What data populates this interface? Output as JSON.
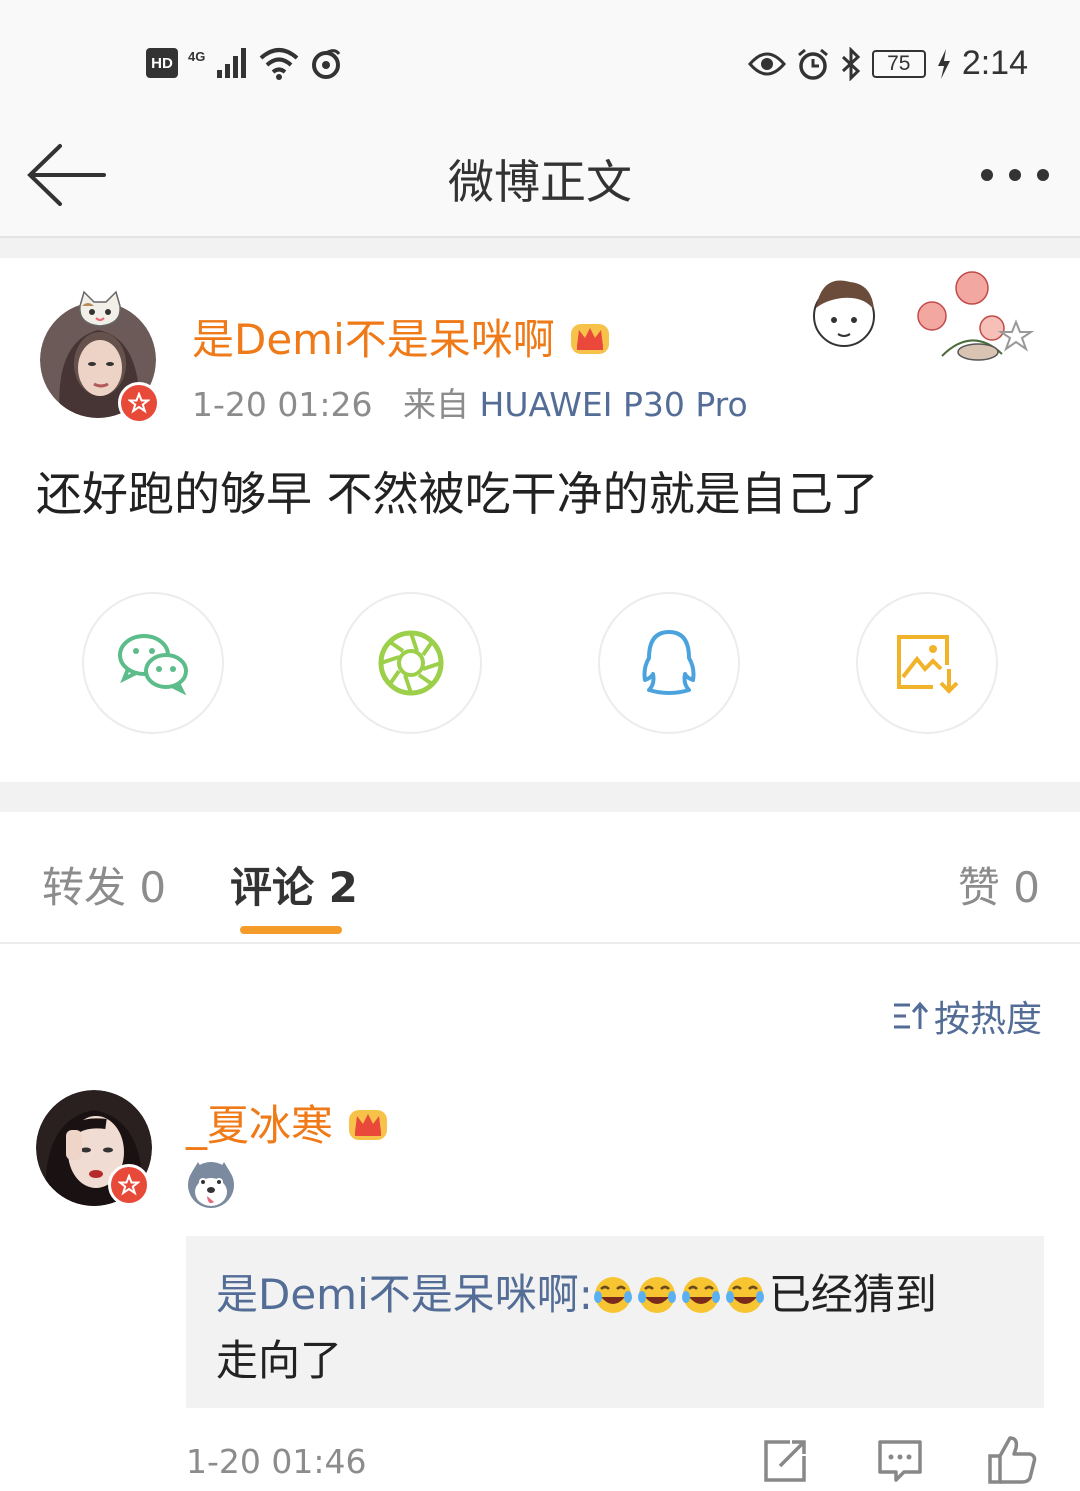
{
  "status_bar": {
    "hd": "HD",
    "network": "4G",
    "battery": "75",
    "time": "2:14"
  },
  "nav": {
    "title": "微博正文"
  },
  "post": {
    "author": "是Demi不是呆咪啊",
    "time": "1-20 01:26",
    "source_prefix": "来自",
    "device": "HUAWEI P30 Pro",
    "text": "还好跑的够早 不然被吃干净的就是自己了"
  },
  "share_icons": [
    "wechat-icon",
    "moments-icon",
    "qq-icon",
    "save-image-icon"
  ],
  "tabs": {
    "repost": "转发 0",
    "comments": "评论 2",
    "likes": "赞 0"
  },
  "sort": {
    "label": "按热度"
  },
  "comment": {
    "author": "_夏冰寒",
    "reply_author": "是Demi不是呆咪啊:",
    "reply_text_1": "已经猜到",
    "reply_text_2": "走向了",
    "time": "1-20 01:46"
  },
  "colors": {
    "username": "#ef7a17",
    "link": "#536d97",
    "accent": "#f49b2a",
    "vip_red": "#e84a3a"
  }
}
